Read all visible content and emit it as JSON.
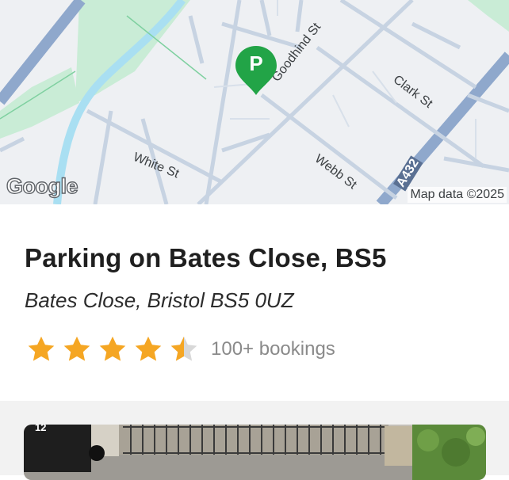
{
  "map": {
    "streets": {
      "goodhind": "Goodhind St",
      "clark": "Clark St",
      "white": "White St",
      "webb": "Webb St",
      "road_number": "A432"
    },
    "attribution": "Map data ©2025",
    "logo": "Google",
    "marker_icon": "parking-pin-icon",
    "marker_letter": "P",
    "marker_color": "#22a447"
  },
  "listing": {
    "title": "Parking on Bates Close, BS5",
    "address": "Bates Close, Bristol BS5 0UZ",
    "rating": 4.5,
    "rating_max": 5,
    "bookings": "100+ bookings",
    "star_color": "#f5a623"
  },
  "photo": {
    "bin_number": "12"
  }
}
